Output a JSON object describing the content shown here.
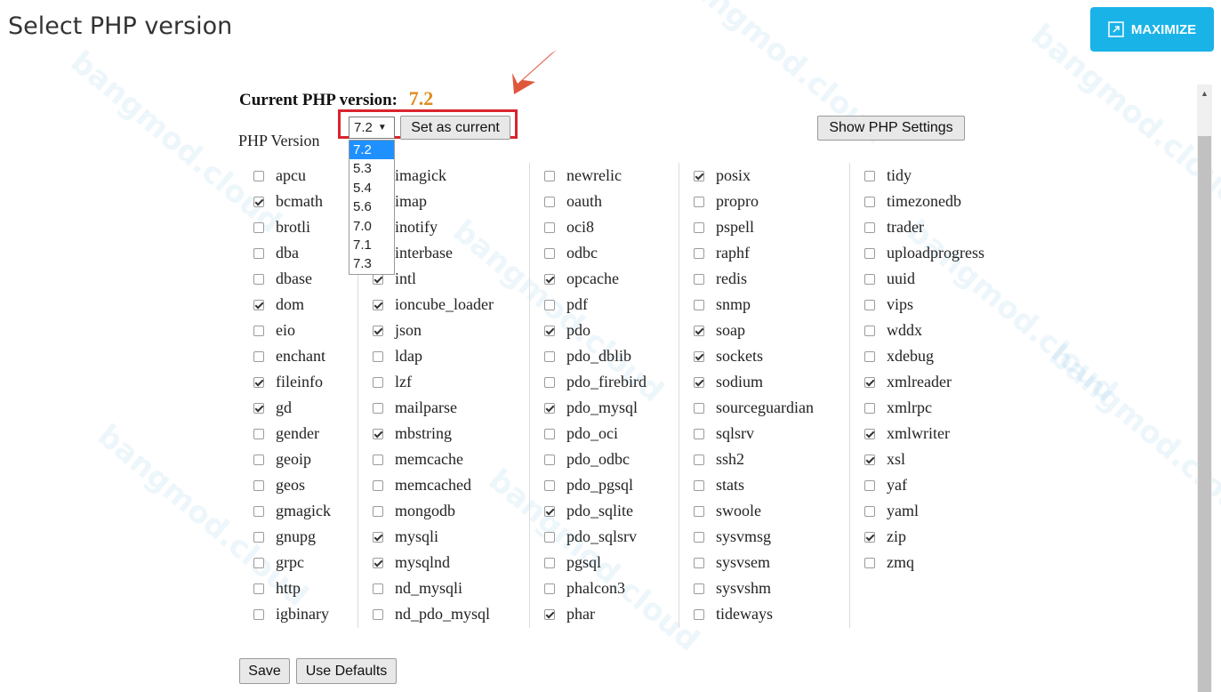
{
  "header": {
    "title": "Select PHP version",
    "maximize_label": "MAXIMIZE"
  },
  "current": {
    "label": "Current PHP version:",
    "value": "7.2"
  },
  "version_select": {
    "selected": "7.2",
    "options": [
      "7.2",
      "5.3",
      "5.4",
      "5.6",
      "7.0",
      "7.1",
      "7.3"
    ]
  },
  "buttons": {
    "set_current": "Set as current",
    "show_settings": "Show PHP Settings",
    "save": "Save",
    "defaults": "Use Defaults"
  },
  "php_version_label": "PHP Version",
  "watermark_text": "bangmod.cloud",
  "colors": {
    "maximize_bg": "#1ab3e8",
    "current_value": "#e08a1e",
    "highlight": "#d9242f",
    "arrow": "#e0563a"
  },
  "extensions": [
    [
      {
        "name": "apcu",
        "checked": false
      },
      {
        "name": "bcmath",
        "checked": true
      },
      {
        "name": "brotli",
        "checked": false
      },
      {
        "name": "dba",
        "checked": false
      },
      {
        "name": "dbase",
        "checked": false
      },
      {
        "name": "dom",
        "checked": true
      },
      {
        "name": "eio",
        "checked": false
      },
      {
        "name": "enchant",
        "checked": false
      },
      {
        "name": "fileinfo",
        "checked": true
      },
      {
        "name": "gd",
        "checked": true
      },
      {
        "name": "gender",
        "checked": false
      },
      {
        "name": "geoip",
        "checked": false
      },
      {
        "name": "geos",
        "checked": false
      },
      {
        "name": "gmagick",
        "checked": false
      },
      {
        "name": "gnupg",
        "checked": false
      },
      {
        "name": "grpc",
        "checked": false
      },
      {
        "name": "http",
        "checked": false
      },
      {
        "name": "igbinary",
        "checked": false
      }
    ],
    [
      {
        "name": "imagick",
        "checked": false
      },
      {
        "name": "imap",
        "checked": false
      },
      {
        "name": "inotify",
        "checked": false
      },
      {
        "name": "interbase",
        "checked": false
      },
      {
        "name": "intl",
        "checked": true
      },
      {
        "name": "ioncube_loader",
        "checked": true
      },
      {
        "name": "json",
        "checked": true
      },
      {
        "name": "ldap",
        "checked": false
      },
      {
        "name": "lzf",
        "checked": false
      },
      {
        "name": "mailparse",
        "checked": false
      },
      {
        "name": "mbstring",
        "checked": true
      },
      {
        "name": "memcache",
        "checked": false
      },
      {
        "name": "memcached",
        "checked": false
      },
      {
        "name": "mongodb",
        "checked": false
      },
      {
        "name": "mysqli",
        "checked": true
      },
      {
        "name": "mysqlnd",
        "checked": true
      },
      {
        "name": "nd_mysqli",
        "checked": false
      },
      {
        "name": "nd_pdo_mysql",
        "checked": false
      }
    ],
    [
      {
        "name": "newrelic",
        "checked": false
      },
      {
        "name": "oauth",
        "checked": false
      },
      {
        "name": "oci8",
        "checked": false
      },
      {
        "name": "odbc",
        "checked": false
      },
      {
        "name": "opcache",
        "checked": true
      },
      {
        "name": "pdf",
        "checked": false
      },
      {
        "name": "pdo",
        "checked": true
      },
      {
        "name": "pdo_dblib",
        "checked": false
      },
      {
        "name": "pdo_firebird",
        "checked": false
      },
      {
        "name": "pdo_mysql",
        "checked": true
      },
      {
        "name": "pdo_oci",
        "checked": false
      },
      {
        "name": "pdo_odbc",
        "checked": false
      },
      {
        "name": "pdo_pgsql",
        "checked": false
      },
      {
        "name": "pdo_sqlite",
        "checked": true
      },
      {
        "name": "pdo_sqlsrv",
        "checked": false
      },
      {
        "name": "pgsql",
        "checked": false
      },
      {
        "name": "phalcon3",
        "checked": false
      },
      {
        "name": "phar",
        "checked": true
      }
    ],
    [
      {
        "name": "posix",
        "checked": true
      },
      {
        "name": "propro",
        "checked": false
      },
      {
        "name": "pspell",
        "checked": false
      },
      {
        "name": "raphf",
        "checked": false
      },
      {
        "name": "redis",
        "checked": false
      },
      {
        "name": "snmp",
        "checked": false
      },
      {
        "name": "soap",
        "checked": true
      },
      {
        "name": "sockets",
        "checked": true
      },
      {
        "name": "sodium",
        "checked": true
      },
      {
        "name": "sourceguardian",
        "checked": false
      },
      {
        "name": "sqlsrv",
        "checked": false
      },
      {
        "name": "ssh2",
        "checked": false
      },
      {
        "name": "stats",
        "checked": false
      },
      {
        "name": "swoole",
        "checked": false
      },
      {
        "name": "sysvmsg",
        "checked": false
      },
      {
        "name": "sysvsem",
        "checked": false
      },
      {
        "name": "sysvshm",
        "checked": false
      },
      {
        "name": "tideways",
        "checked": false
      }
    ],
    [
      {
        "name": "tidy",
        "checked": false
      },
      {
        "name": "timezonedb",
        "checked": false
      },
      {
        "name": "trader",
        "checked": false
      },
      {
        "name": "uploadprogress",
        "checked": false
      },
      {
        "name": "uuid",
        "checked": false
      },
      {
        "name": "vips",
        "checked": false
      },
      {
        "name": "wddx",
        "checked": false
      },
      {
        "name": "xdebug",
        "checked": false
      },
      {
        "name": "xmlreader",
        "checked": true
      },
      {
        "name": "xmlrpc",
        "checked": false
      },
      {
        "name": "xmlwriter",
        "checked": true
      },
      {
        "name": "xsl",
        "checked": true
      },
      {
        "name": "yaf",
        "checked": false
      },
      {
        "name": "yaml",
        "checked": false
      },
      {
        "name": "zip",
        "checked": true
      },
      {
        "name": "zmq",
        "checked": false
      }
    ]
  ]
}
